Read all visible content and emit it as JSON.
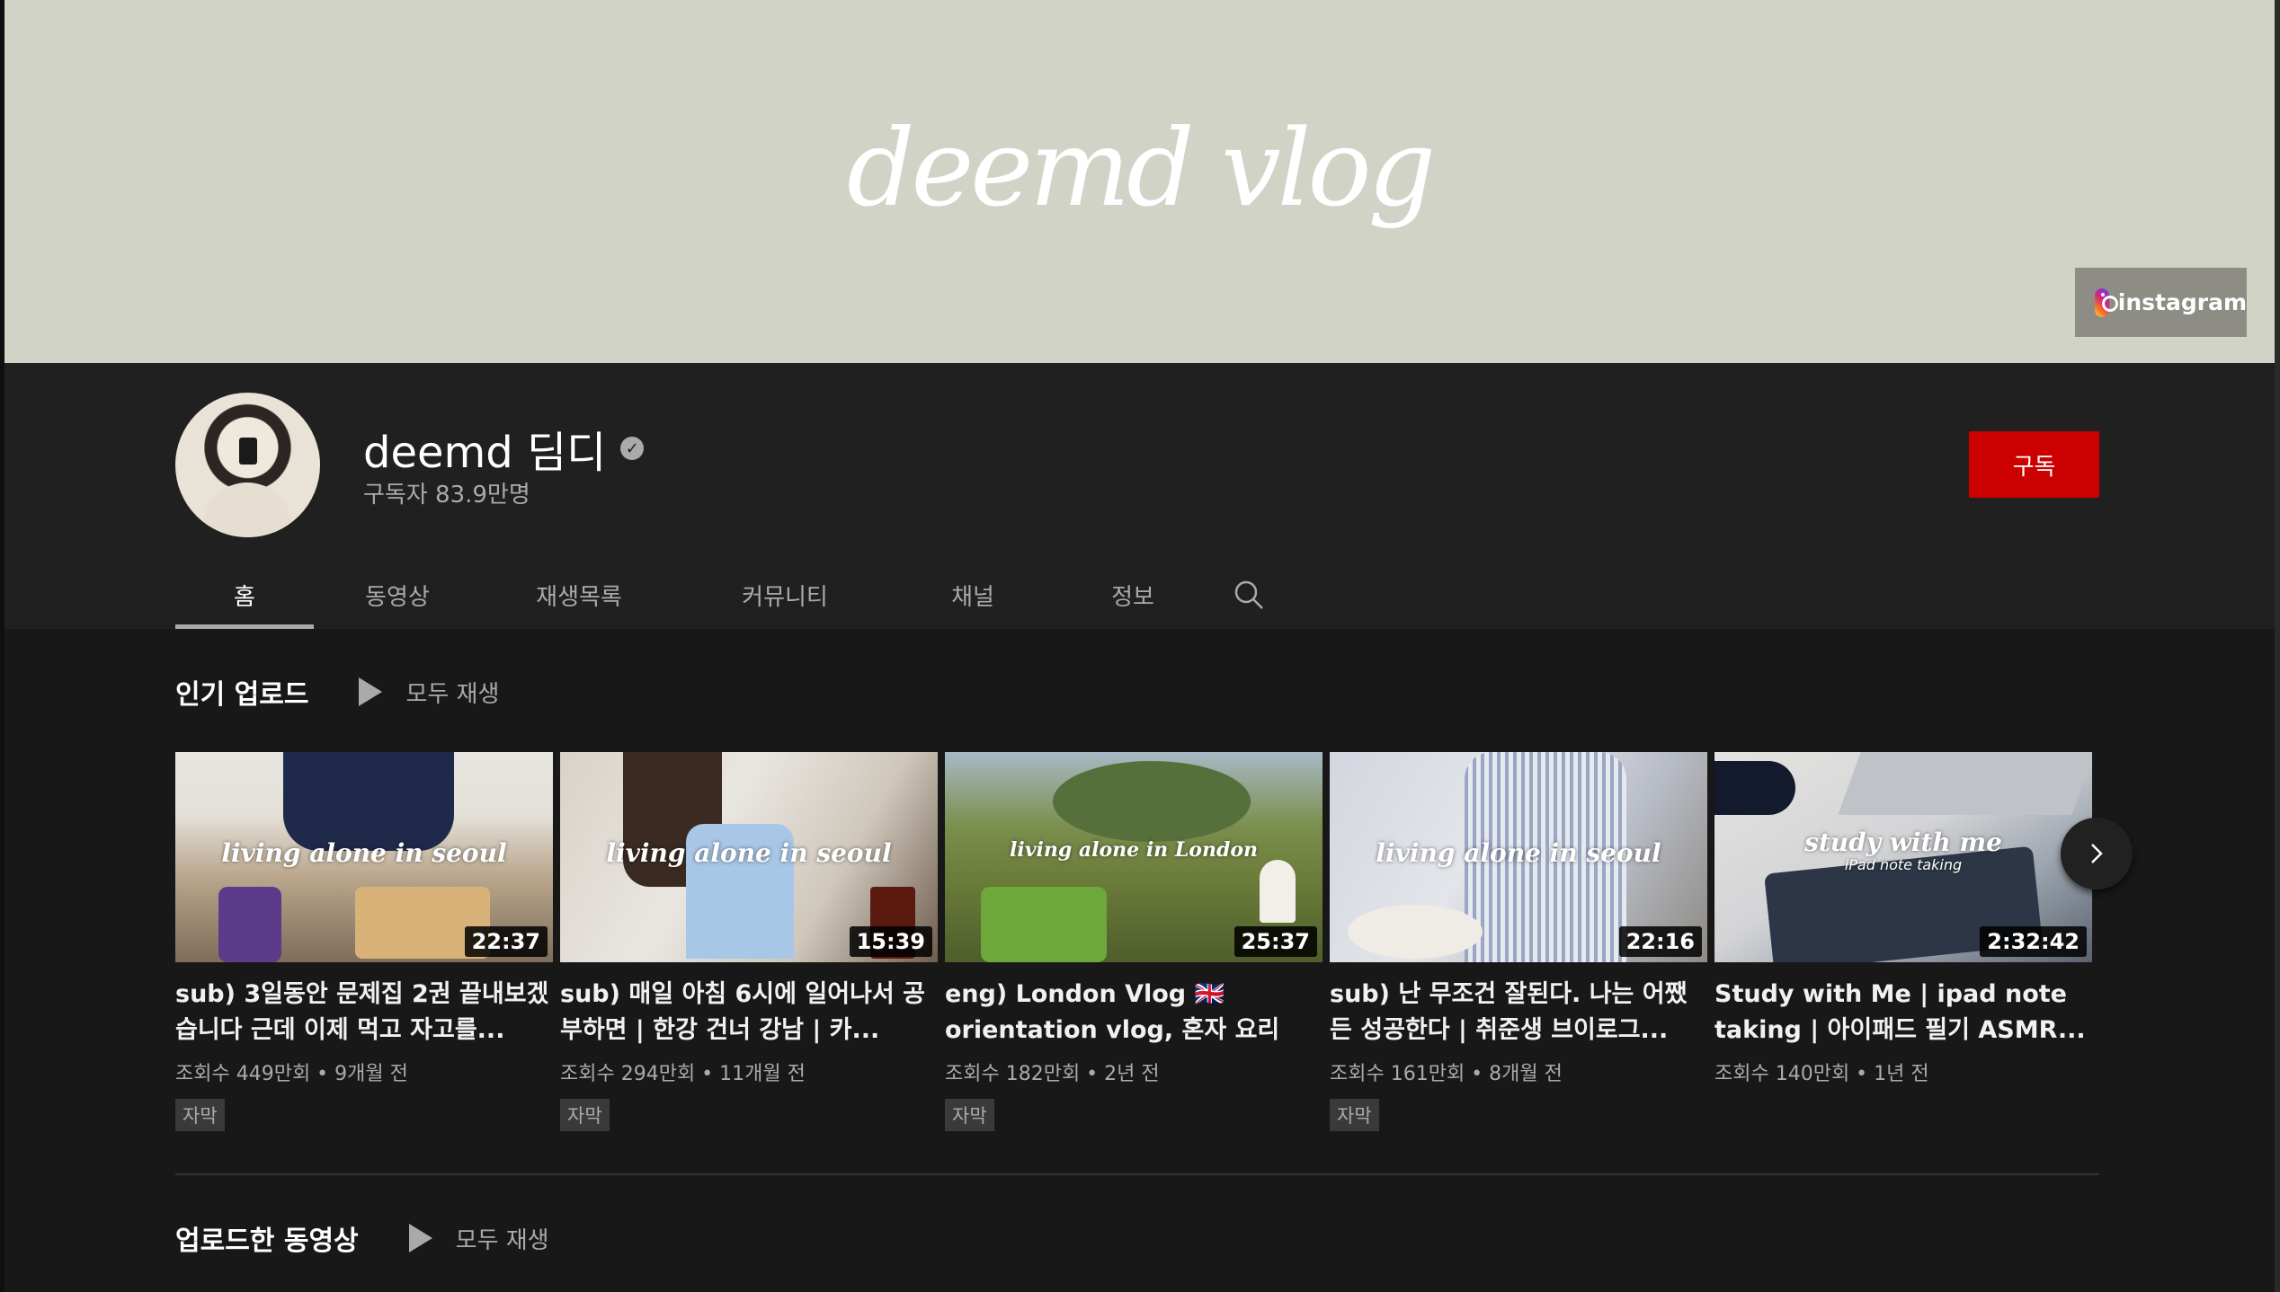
{
  "banner": {
    "title": "deemd vlog",
    "link_label": "instagram"
  },
  "channel": {
    "name": "deemd 딤디",
    "subscribers": "구독자 83.9만명",
    "subscribe_label": "구독"
  },
  "tabs": [
    {
      "label": "홈",
      "active": true
    },
    {
      "label": "동영상"
    },
    {
      "label": "재생목록"
    },
    {
      "label": "커뮤니티"
    },
    {
      "label": "채널"
    },
    {
      "label": "정보"
    }
  ],
  "sections": {
    "popular": {
      "title": "인기 업로드",
      "play_all": "모두 재생"
    },
    "uploads": {
      "title": "업로드한 동영상",
      "play_all": "모두 재생"
    }
  },
  "videos": [
    {
      "thumb_text": "living alone in seoul",
      "duration": "22:37",
      "title": "sub) 3일동안 문제집 2권 끝내보겠습니다 근데 이제 먹고 자고를...",
      "meta": "조회수 449만회 • 9개월 전",
      "badge": "자막"
    },
    {
      "thumb_text": "living alone in seoul",
      "duration": "15:39",
      "title": "sub) 매일 아침 6시에 일어나서 공부하면 | 한강 건너 강남 | 카...",
      "meta": "조회수 294만회 • 11개월 전",
      "badge": "자막"
    },
    {
      "thumb_text": "living alone in London",
      "duration": "25:37",
      "title": "eng) London Vlog 🇬🇧 orientation vlog, 혼자 요리하...",
      "meta": "조회수 182만회 • 2년 전",
      "badge": "자막"
    },
    {
      "thumb_text": "living alone in seoul",
      "duration": "22:16",
      "title": "sub) 난 무조건 잘된다. 나는 어쨌든 성공한다 | 취준생 브이로그...",
      "meta": "조회수 161만회 • 8개월 전",
      "badge": "자막"
    },
    {
      "thumb_text": "study with me",
      "thumb_sub": "iPad note taking",
      "duration": "2:32:42",
      "title": "Study with Me | ipad note taking | 아이패드 필기 ASMR...",
      "meta": "조회수 140만회 • 1년 전",
      "badge": ""
    }
  ],
  "icons": {
    "verified": "verified-check-icon",
    "search": "search-icon",
    "next": "chevron-right-icon",
    "play": "play-icon",
    "instagram": "instagram-icon"
  },
  "colors": {
    "subscribe": "#cc0000",
    "banner_bg": "#d2d3c7",
    "header_bg": "#202020",
    "page_bg": "#181818"
  }
}
